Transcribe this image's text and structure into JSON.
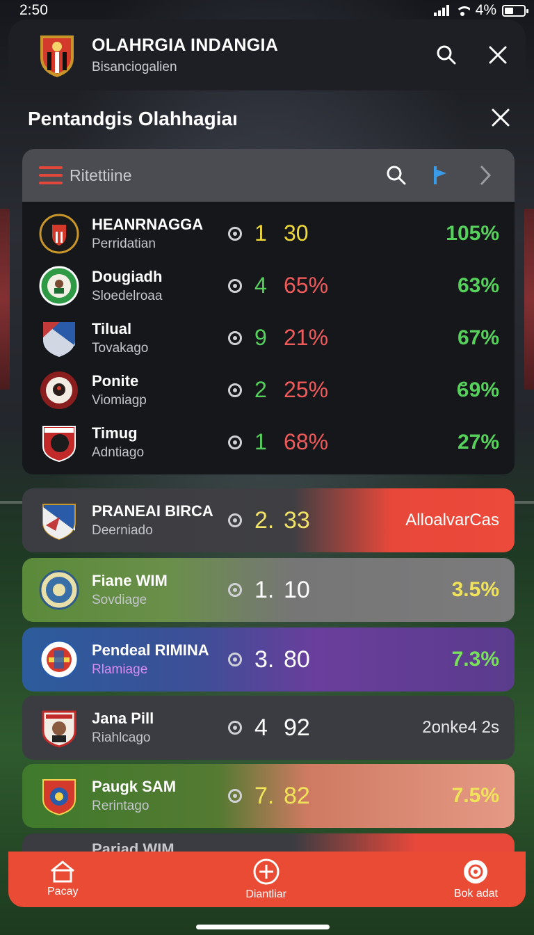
{
  "status": {
    "time": "2:50",
    "battery": "4%"
  },
  "header": {
    "title": "OLAHRGIA INDANGIA",
    "subtitle": "Bisanciogalien"
  },
  "panel": {
    "title": "Pentandgis Olahhagiaı"
  },
  "toolbar": {
    "label": "Ritettiine"
  },
  "rows": [
    {
      "name": "HEANRNAGGA",
      "sub": "Perridatian",
      "n1": "1",
      "n2": "30",
      "pct": "105%",
      "n1_color": "#f0d93a",
      "n2_color": "#f0d93a",
      "pct_color": "#56d25c"
    },
    {
      "name": "Dougiadh",
      "sub": "Sloedelroaa",
      "n1": "4",
      "n2": "65%",
      "pct": "63%",
      "n1_color": "#56d25c",
      "n2_color": "#ef5b5b",
      "pct_color": "#56d25c"
    },
    {
      "name": "Tilual",
      "sub": "Tovakago",
      "n1": "9",
      "n2": "21%",
      "pct": "67%",
      "n1_color": "#56d25c",
      "n2_color": "#ef5b5b",
      "pct_color": "#56d25c"
    },
    {
      "name": "Ponite",
      "sub": "Viomiagp",
      "n1": "2",
      "n2": "25%",
      "pct": "ϐ9%",
      "n1_color": "#56d25c",
      "n2_color": "#ef5b5b",
      "pct_color": "#56d25c"
    },
    {
      "name": "Timug",
      "sub": "Adntiago",
      "n1": "1",
      "n2": "68%",
      "pct": "27%",
      "n1_color": "#56d25c",
      "n2_color": "#ef5b5b",
      "pct_color": "#56d25c"
    }
  ],
  "cards": [
    {
      "name": "PRANEAI BIRCA",
      "sub": "Deerniado",
      "n1": "2.",
      "n2": "33",
      "right": "AlloalvarCas",
      "num_color": "#f0e368",
      "right_color": "#ffffff"
    },
    {
      "name": "Fiane WIM",
      "sub": "Sovdiage",
      "n1": "1.",
      "n2": "10",
      "right": "3.5%",
      "num_color": "#ffffff",
      "right_color": "#f0e35a"
    },
    {
      "name": "Pendeal RIMINA",
      "sub": "Rlamiage",
      "n1": "3.",
      "n2": "80",
      "right": "7.3%",
      "num_color": "#ffffff",
      "right_color": "#78e05a",
      "sub_color": "#d68cf0"
    },
    {
      "name": "Jana Pill",
      "sub": "Riahlcago",
      "n1": "4",
      "n2": "92",
      "right": "2onke4 2s",
      "num_color": "#ffffff",
      "right_color": "#e8e8ea"
    },
    {
      "name": "Paugk SAM",
      "sub": "Rerintago",
      "n1": "7.",
      "n2": "82",
      "right": "7.5%",
      "num_color": "#f0e35a",
      "right_color": "#f0e35a"
    },
    {
      "name": "Pariad WIM",
      "sub": "",
      "n1": "",
      "n2": "",
      "right": "",
      "num_color": "#ffffff",
      "right_color": "#ffffff"
    }
  ],
  "nav": [
    {
      "label": "Pacay",
      "icon": "home-icon"
    },
    {
      "label": "Diantliar",
      "icon": "plus-circle-icon"
    },
    {
      "label": "Bok adat",
      "icon": "record-icon"
    }
  ]
}
